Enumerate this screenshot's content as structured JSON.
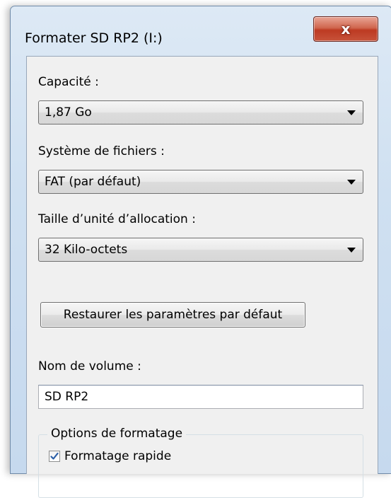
{
  "window": {
    "title": "Formater SD RP2 (I:)",
    "close_glyph": "x",
    "close_icon": "close-icon"
  },
  "capacity": {
    "label": "Capacité :",
    "value": "1,87 Go"
  },
  "filesystem": {
    "label": "Système de fichiers :",
    "value": "FAT (par défaut)"
  },
  "allocation": {
    "label": "Taille d’unité d’allocation :",
    "value": "32 Kilo-octets"
  },
  "restore_button": {
    "label": "Restaurer les paramètres par défaut"
  },
  "volume": {
    "label": "Nom de volume :",
    "value": "SD RP2"
  },
  "format_options": {
    "legend": "Options de formatage",
    "quick_format": {
      "label": "Formatage rapide",
      "checked": true
    }
  },
  "colors": {
    "close_button": "#c7533a",
    "window_frame": "#cfe0f1",
    "client_bg": "#f0f0f0",
    "checkmark": "#2a5ea7"
  }
}
